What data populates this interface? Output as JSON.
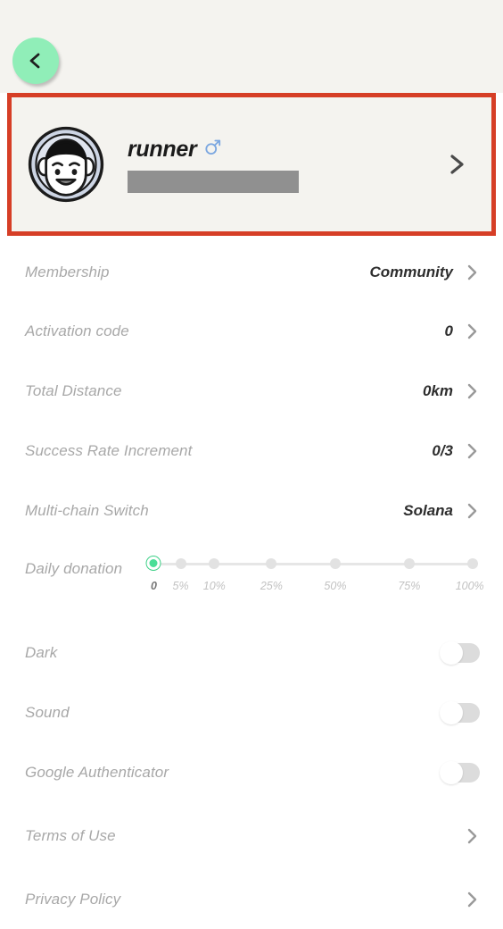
{
  "theme": {
    "header_bg": "#f4f3ef",
    "page_bg": "#ffffff",
    "accent_green": "#90eeb8",
    "slider_green": "#4ade97",
    "highlight_border": "#d63e26",
    "label_gray": "#a8a8a8",
    "value_dark": "#2e2e2e",
    "gender_blue": "#7ba7e0",
    "redaction_gray": "#909090"
  },
  "header": {
    "back_button": {
      "icon": "chevron-left-icon",
      "label": "Back"
    }
  },
  "profile": {
    "avatar_icon": "user-avatar-face-icon",
    "username": "runner",
    "gender_icon": "male-gender-icon",
    "redacted_value": "",
    "chevron": "chevron-right-icon",
    "highlighted": true
  },
  "settings": {
    "rows": [
      {
        "label": "Membership",
        "value": "Community",
        "chevron": true
      },
      {
        "label": "Activation code",
        "value": "0",
        "chevron": true
      },
      {
        "label": "Total Distance",
        "value": "0km",
        "chevron": true
      },
      {
        "label": "Success Rate Increment",
        "value": "0/3",
        "chevron": true
      },
      {
        "label": "Multi-chain Switch",
        "value": "Solana",
        "chevron": true
      }
    ]
  },
  "daily_donation": {
    "label": "Daily donation",
    "selected_index": 0,
    "stops": [
      {
        "label": "0",
        "pos": 0
      },
      {
        "label": "5%",
        "pos": 8.5
      },
      {
        "label": "10%",
        "pos": 19
      },
      {
        "label": "25%",
        "pos": 37.5
      },
      {
        "label": "50%",
        "pos": 56.5
      },
      {
        "label": "75%",
        "pos": 79.5
      },
      {
        "label": "100%",
        "pos": 100
      }
    ]
  },
  "toggles": [
    {
      "label": "Dark",
      "on": false
    },
    {
      "label": "Sound",
      "on": false
    },
    {
      "label": "Google Authenticator",
      "on": false
    }
  ],
  "links": [
    {
      "label": "Terms of Use",
      "chevron": true
    },
    {
      "label": "Privacy Policy",
      "chevron": true
    }
  ]
}
